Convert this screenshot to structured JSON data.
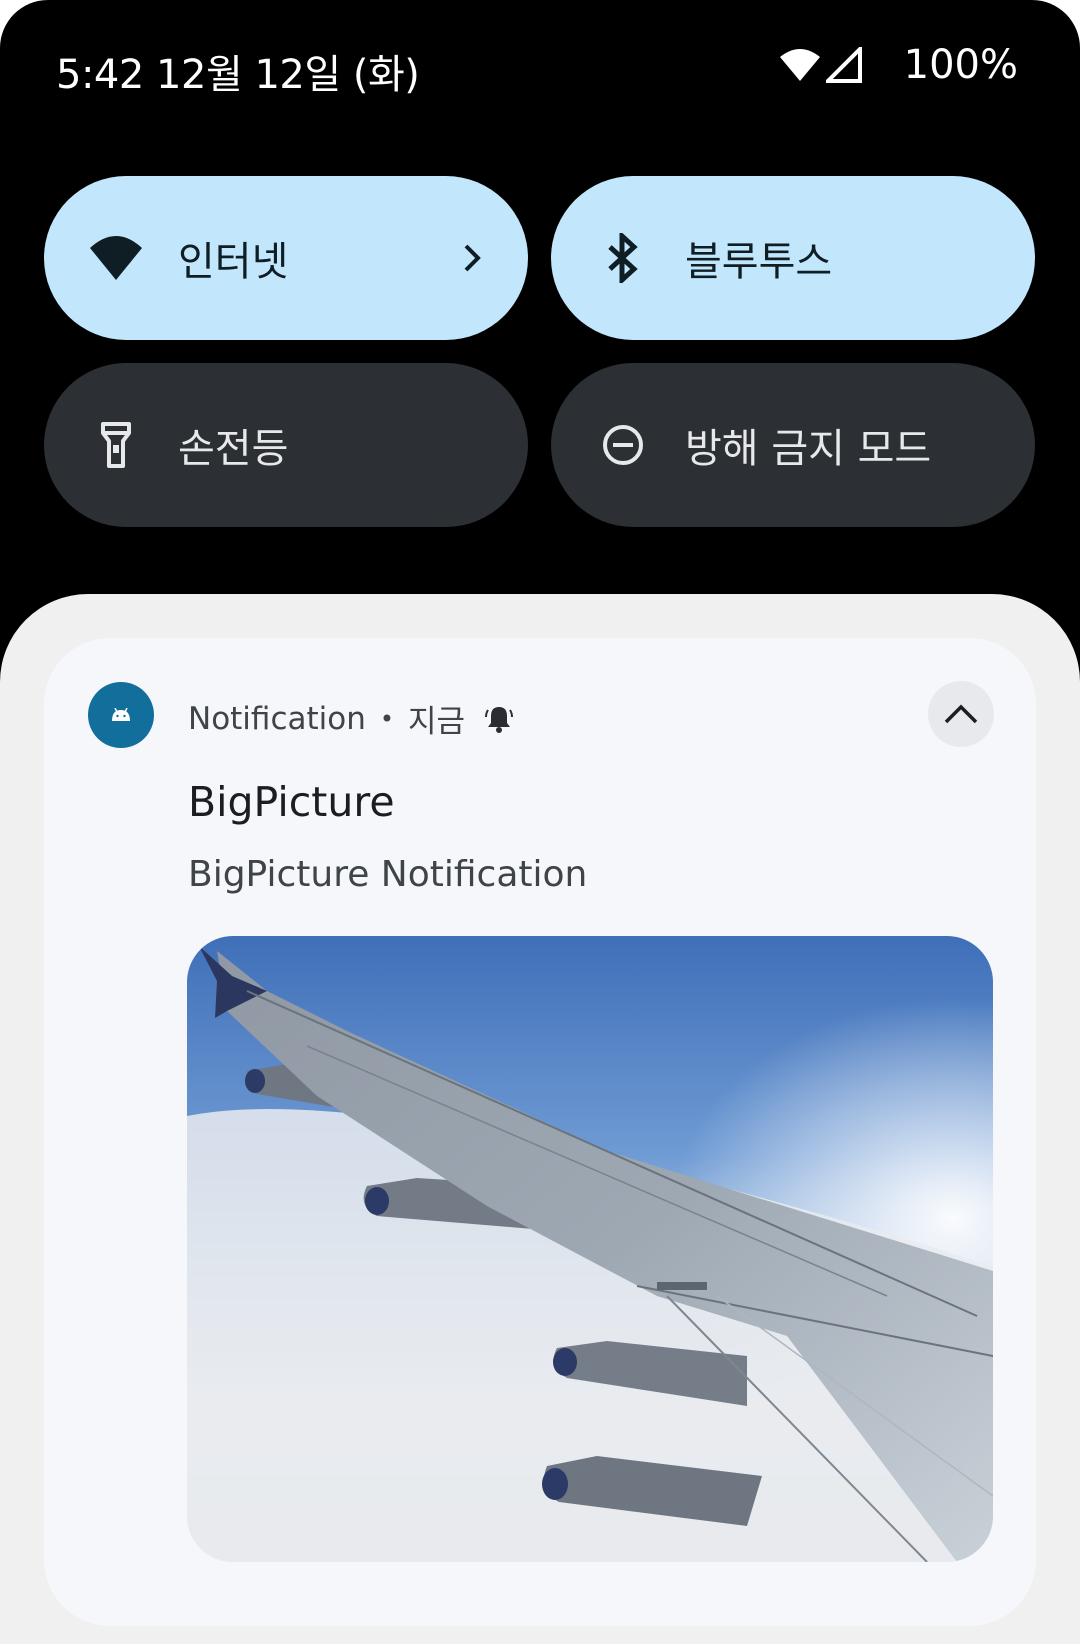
{
  "status_bar": {
    "time_date": "5:42 12월 12일 (화)",
    "battery": "100%",
    "icons": [
      "wifi-icon",
      "signal-icon"
    ]
  },
  "quick_settings": {
    "tiles": [
      {
        "label": "인터넷",
        "icon": "wifi-icon",
        "state": "on",
        "has_chevron": true
      },
      {
        "label": "블루투스",
        "icon": "bluetooth-icon",
        "state": "on"
      },
      {
        "label": "손전등",
        "icon": "flashlight-icon",
        "state": "off"
      },
      {
        "label": "방해 금지 모드",
        "icon": "do-not-disturb-icon",
        "state": "off"
      }
    ]
  },
  "notification": {
    "app_name": "Notification",
    "separator": "•",
    "time": "지금",
    "alert_icon": "bell-icon",
    "app_icon": "android-icon",
    "title": "BigPicture",
    "text": "BigPicture Notification",
    "expand_icon": "chevron-up-icon",
    "picture": "airplane-wing-photo"
  },
  "colors": {
    "tile_on": "#c2e7fc",
    "tile_off": "#2c3034",
    "app_icon_bg": "#126e9a",
    "shade_bg": "#f0f0f1",
    "card_bg": "#f6f7fb"
  }
}
